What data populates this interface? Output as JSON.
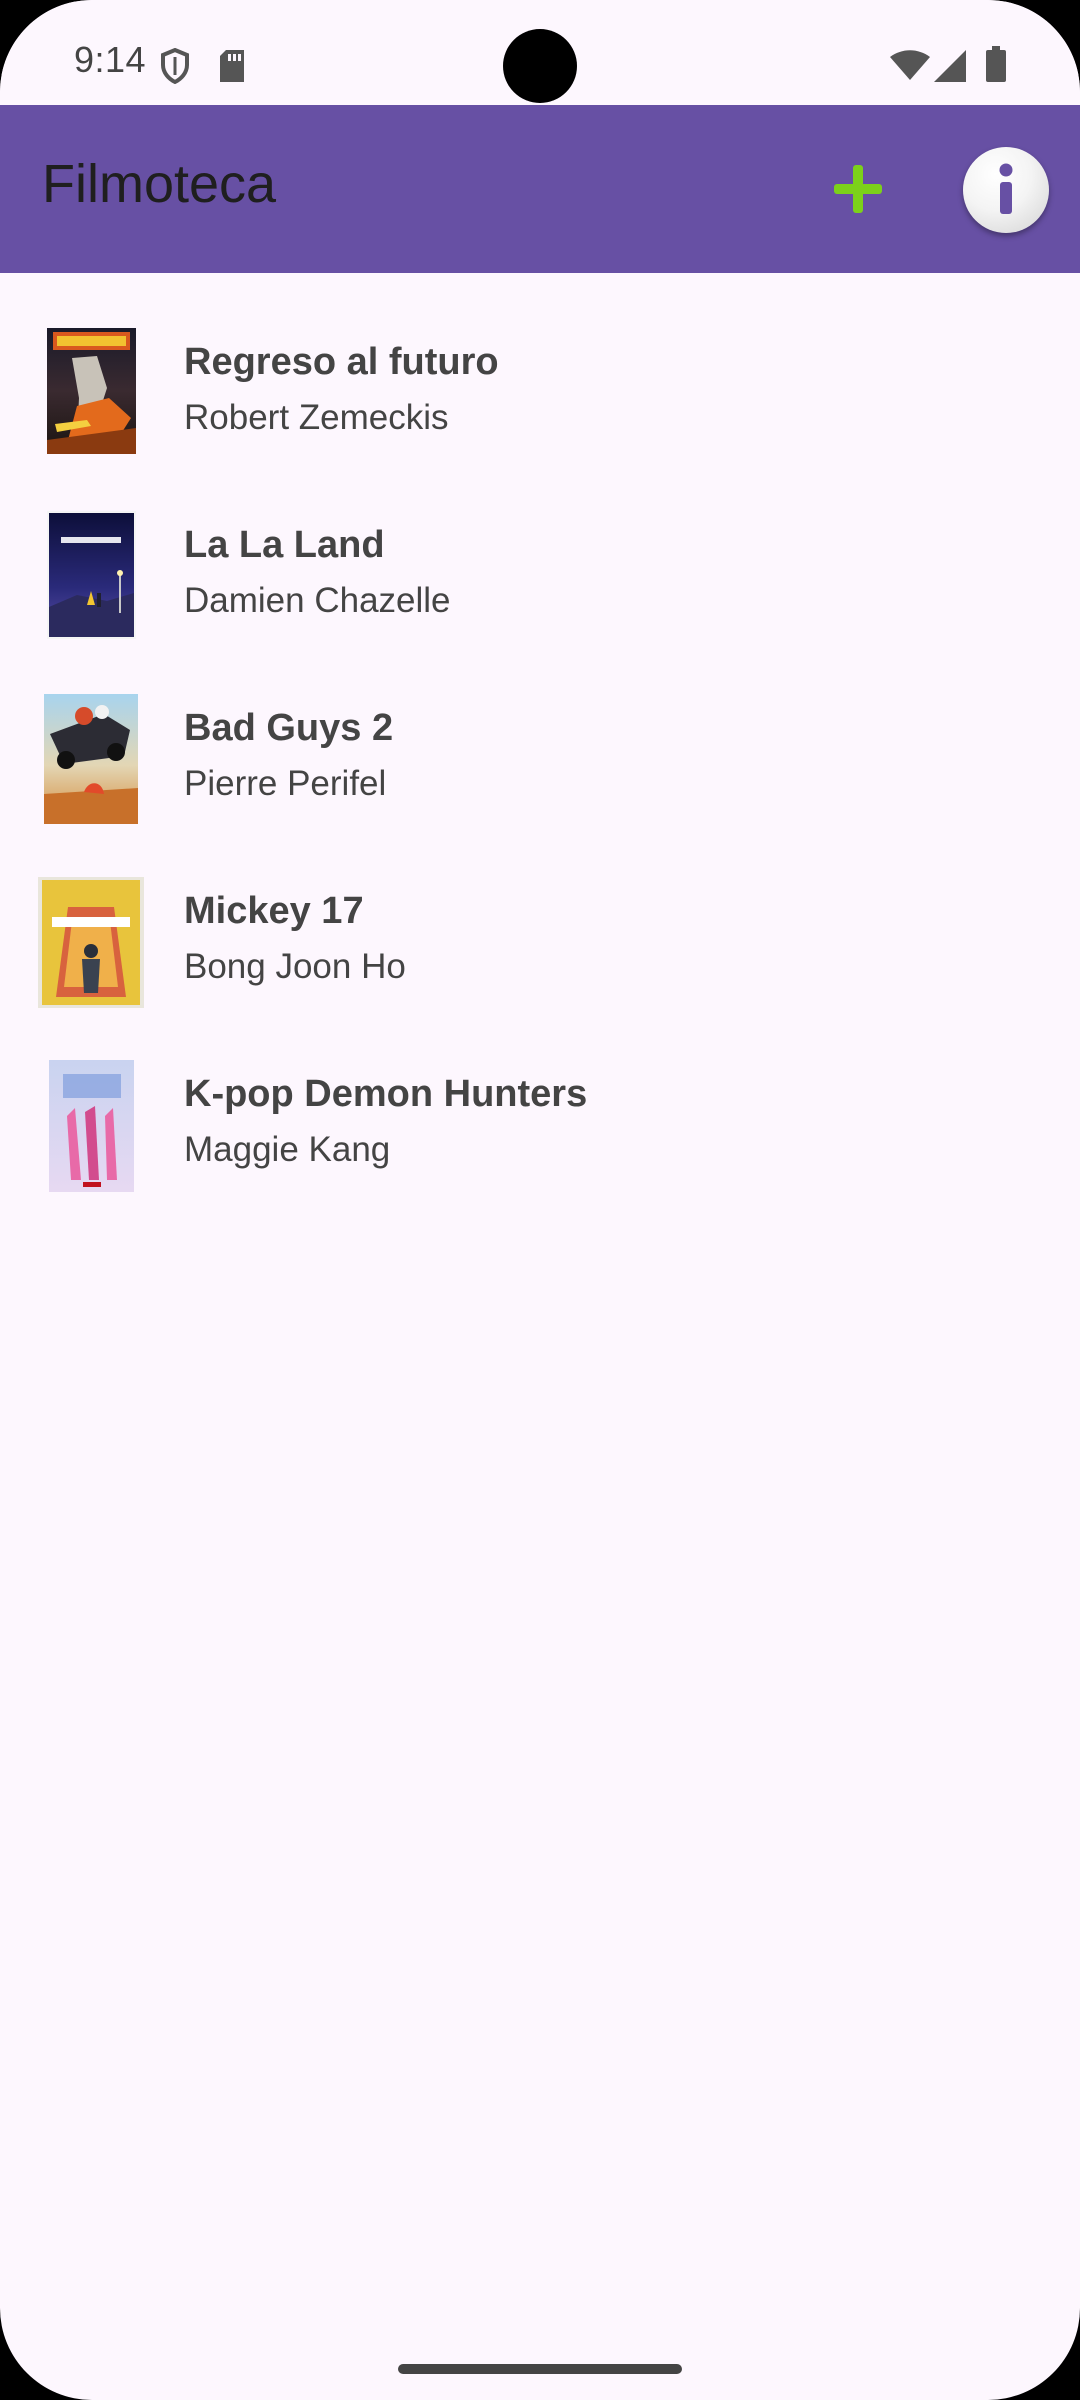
{
  "status_bar": {
    "time": "9:14",
    "icons": [
      "shield-icon",
      "sd-card-icon",
      "wifi-icon",
      "cell-signal-icon",
      "battery-icon"
    ]
  },
  "app_bar": {
    "title": "Filmoteca",
    "background_color": "#6750a4",
    "actions": [
      {
        "icon": "add-icon",
        "color": "#7cd11a"
      },
      {
        "icon": "info-icon",
        "color": "#6750a4"
      }
    ]
  },
  "movies": [
    {
      "title": "Regreso al futuro",
      "director": "Robert Zemeckis"
    },
    {
      "title": "La La Land",
      "director": "Damien Chazelle"
    },
    {
      "title": "Bad Guys 2",
      "director": "Pierre Perifel"
    },
    {
      "title": "Mickey 17",
      "director": "Bong Joon Ho"
    },
    {
      "title": "K-pop Demon Hunters",
      "director": "Maggie Kang"
    }
  ]
}
